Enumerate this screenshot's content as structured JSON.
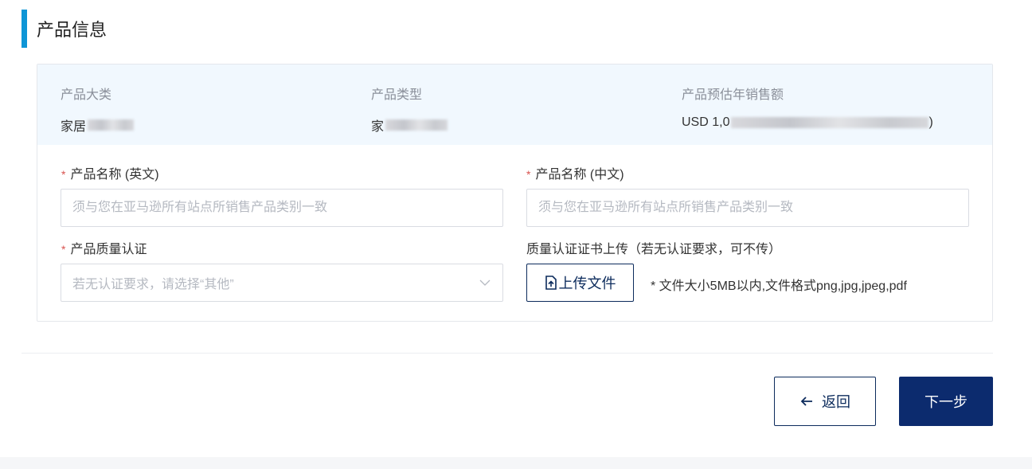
{
  "section": {
    "title": "产品信息",
    "accent_color": "#0d95d6"
  },
  "info": {
    "category": {
      "label": "产品大类",
      "value_visible": "家居"
    },
    "type": {
      "label": "产品类型",
      "value_visible": "家"
    },
    "sales": {
      "label": "产品预估年销售额",
      "value_prefix": "USD 1,0",
      "value_suffix": ")"
    }
  },
  "form": {
    "name_en": {
      "required_mark": "*",
      "label": "产品名称 (英文)",
      "placeholder": "须与您在亚马逊所有站点所销售产品类别一致",
      "value": ""
    },
    "name_cn": {
      "required_mark": "*",
      "label": "产品名称 (中文)",
      "placeholder": "须与您在亚马逊所有站点所销售产品类别一致",
      "value": ""
    },
    "certification": {
      "required_mark": "*",
      "label": "产品质量认证",
      "placeholder": "若无认证要求，请选择“其他”",
      "icon": "chevron-down-icon"
    },
    "cert_upload": {
      "label": "质量认证证书上传（若无认证要求，可不传）",
      "button_label": "上传文件",
      "icon": "file-upload-icon",
      "hint": "* 文件大小5MB以内,文件格式png,jpg,jpeg,pdf"
    }
  },
  "actions": {
    "back_label": "返回",
    "back_icon": "arrow-left-icon",
    "next_label": "下一步",
    "primary_color": "#0c2b6e"
  }
}
